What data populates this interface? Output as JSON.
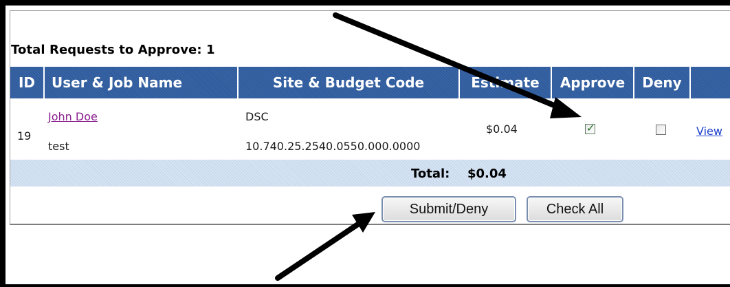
{
  "title": "Total Requests to Approve: 1",
  "columns": [
    "ID",
    "User & Job Name",
    "Site & Budget Code",
    "Estimate",
    "Approve",
    "Deny"
  ],
  "row": {
    "id": "19",
    "user": "John Doe",
    "job": "test",
    "site": "DSC",
    "budget_code": "10.740.25.2540.0550.000.0000",
    "estimate": "$0.04",
    "approve_checked": true,
    "deny_checked": false,
    "view_link": "View"
  },
  "total": {
    "label": "Total:",
    "value": "$0.04"
  },
  "buttons": {
    "submit": "Submit/Deny",
    "check_all": "Check All"
  },
  "colors": {
    "header_bg": "#2f5c9e",
    "total_band": "#d6e4f3",
    "user_link": "#8b1f8e",
    "view_link": "#1a3fcc"
  }
}
